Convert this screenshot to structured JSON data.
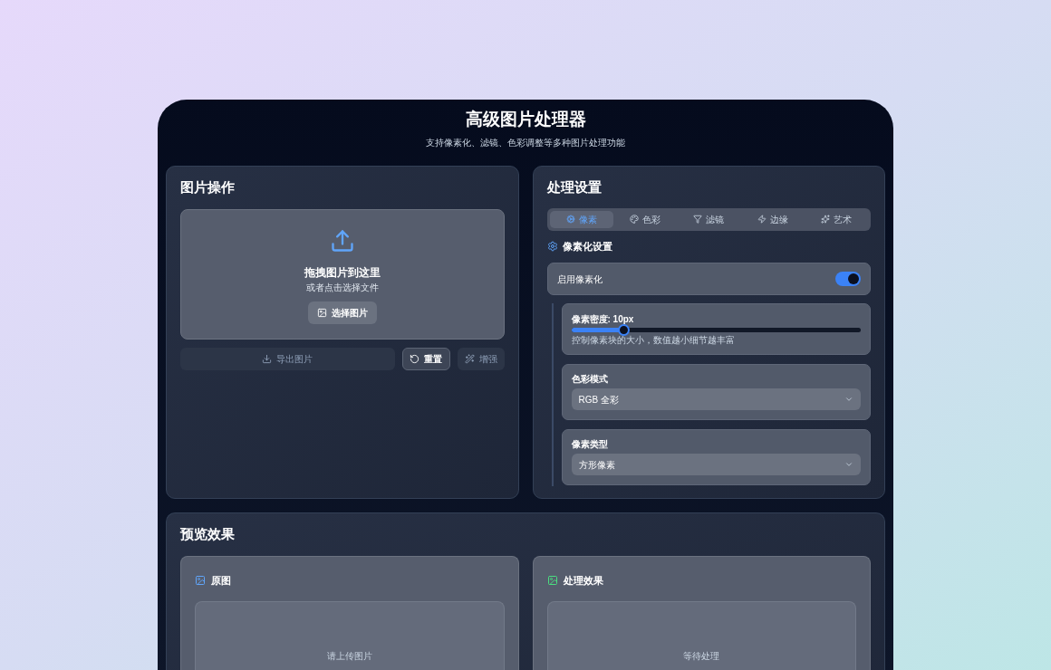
{
  "header": {
    "title": "高级图片处理器",
    "subtitle": "支持像素化、滤镜、色彩调整等多种图片处理功能"
  },
  "upload_panel": {
    "title": "图片操作",
    "dropzone": {
      "heading": "拖拽图片到这里",
      "hint": "或者点击选择文件",
      "button": "选择图片"
    },
    "actions": [
      {
        "kind": "export",
        "label": "导出图片",
        "disabled": true
      },
      {
        "kind": "reset",
        "label": "重置",
        "disabled": false
      },
      {
        "kind": "enhance",
        "label": "增强",
        "disabled": true
      }
    ]
  },
  "settings_panel": {
    "title": "处理设置",
    "tabs": [
      {
        "label": "像素",
        "selected": true
      },
      {
        "label": "色彩",
        "selected": false
      },
      {
        "label": "滤镜",
        "selected": false
      },
      {
        "label": "边缘",
        "selected": false
      },
      {
        "label": "艺术",
        "selected": false
      }
    ],
    "section_title": "像素化设置",
    "toggle": {
      "label": "启用像素化",
      "on": true
    },
    "controls": [
      {
        "kind": "slider",
        "label": "像素密度: 10px",
        "level": 0.18,
        "hint": "控制像素块的大小，数值越小细节越丰富"
      },
      {
        "kind": "select",
        "label": "色彩模式",
        "value": "RGB 全彩"
      },
      {
        "kind": "select",
        "label": "像素类型",
        "value": "方形像素"
      }
    ]
  },
  "preview": {
    "title": "预览效果",
    "panes": [
      {
        "title": "原图",
        "color": "#60a5fa",
        "placeholder": "请上传图片"
      },
      {
        "title": "处理效果",
        "color": "#4ade80",
        "placeholder": "等待处理"
      }
    ]
  }
}
